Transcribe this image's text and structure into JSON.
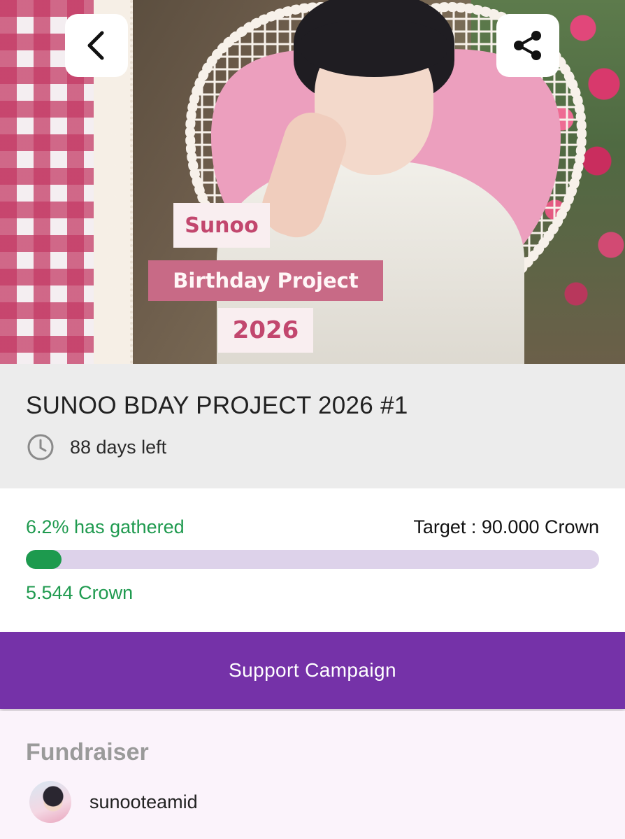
{
  "hero": {
    "banner_lines": {
      "name": "Sunoo",
      "title": "Birthday Project",
      "year": "2026"
    },
    "back_icon": "chevron-left-icon",
    "share_icon": "share-icon"
  },
  "campaign": {
    "title": "SUNOO BDAY PROJECT 2026 #1",
    "days_left": "88 days left",
    "clock_icon": "clock-icon"
  },
  "progress": {
    "gathered_text": "6.2% has gathered",
    "target_text": "Target : 90.000 Crown",
    "amount_text": "5.544 Crown",
    "percent": 6.2
  },
  "actions": {
    "support_label": "Support Campaign"
  },
  "fundraiser": {
    "label": "Fundraiser",
    "name": "sunooteamid"
  },
  "colors": {
    "accent": "#7532a8",
    "progress_green": "#1d9a4e",
    "track": "#ddd2ea",
    "tag_pink": "#c2476e"
  }
}
